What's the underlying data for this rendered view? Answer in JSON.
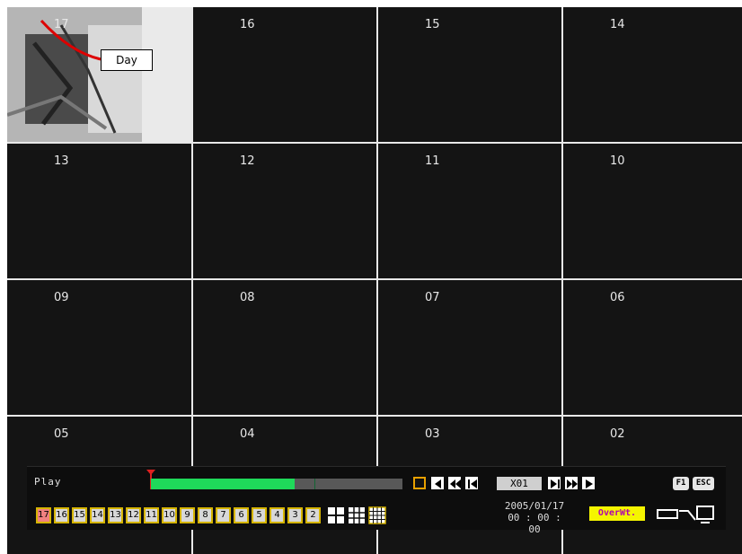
{
  "grid": {
    "cells": [
      "17",
      "16",
      "15",
      "14",
      "13",
      "12",
      "11",
      "10",
      "09",
      "08",
      "07",
      "06",
      "05",
      "04",
      "03",
      "02"
    ]
  },
  "camera_preview": {
    "tooltip": "Day"
  },
  "controls": {
    "mode": "Play",
    "progress_fraction": 0.57,
    "speed": "X01",
    "f1_key": "F1",
    "esc_key": "ESC",
    "date": "2005/01/17",
    "time": "00 : 00 : 00",
    "overwrite": "OverWt.",
    "channels": [
      "17",
      "16",
      "15",
      "14",
      "13",
      "12",
      "11",
      "10",
      "9",
      "8",
      "7",
      "6",
      "5",
      "4",
      "3",
      "2"
    ],
    "active_channel": "17"
  },
  "colors": {
    "progress_fill": "#1fd95a",
    "stop_border": "#e8a000",
    "channel_border": "#d5b400",
    "overwrite_bg": "#f5f500"
  }
}
